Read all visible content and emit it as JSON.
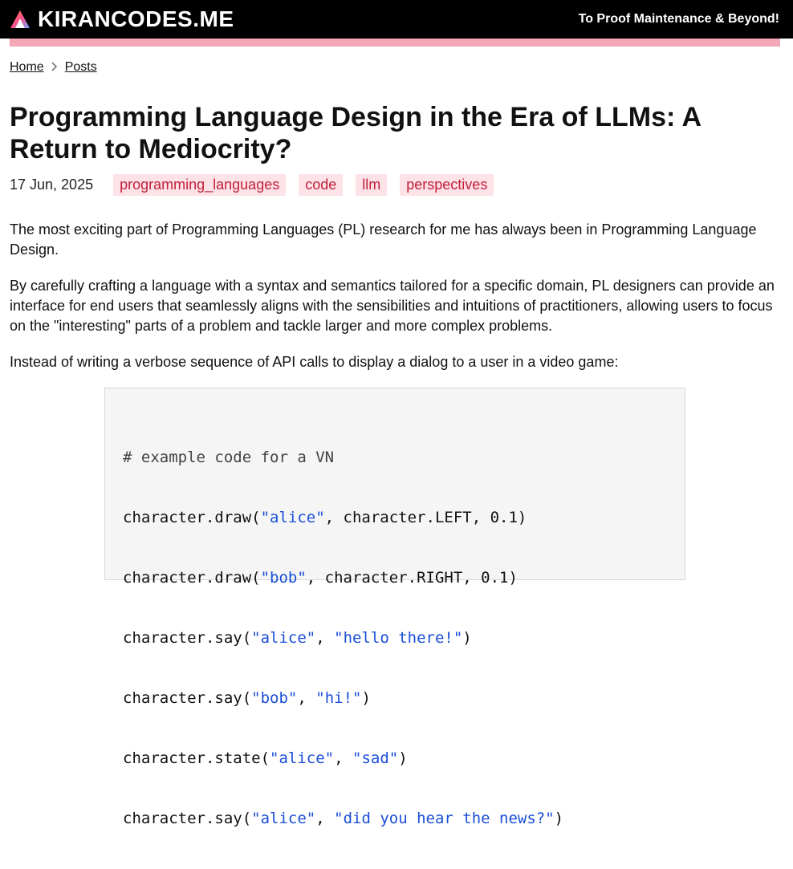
{
  "header": {
    "site_name": "KIRANCODES.ME",
    "tagline": "To Proof Maintenance & Beyond!",
    "logo_icon": "triangle-logo-icon"
  },
  "breadcrumb": {
    "home": "Home",
    "posts": "Posts",
    "separator_icon": "chevron-right-icon"
  },
  "post": {
    "title": "Programming Language Design in the Era of LLMs: A Return to Mediocrity?",
    "date": "17 Jun, 2025",
    "tags": [
      "programming_languages",
      "code",
      "llm",
      "perspectives"
    ],
    "paragraphs": [
      "The most exciting part of Programming Languages (PL) research for me has always been in Programming Language Design.",
      "By carefully crafting a language with a syntax and semantics tailored for a specific domain, PL designers can provide an interface for end users that seamlessly aligns with the sensibilities and intuitions of practitioners, allowing users to focus on the \"interesting\" parts of a problem and tackle larger and more complex problems.",
      "Instead of writing a verbose sequence of API calls to display a dialog to a user in a video game:"
    ],
    "code": {
      "comment": "# example code for a VN",
      "lines": [
        {
          "pre": "character.draw(",
          "s1": "\"alice\"",
          "mid": ", character.LEFT, 0.1)",
          "s2": "",
          "post": ""
        },
        {
          "pre": "character.draw(",
          "s1": "\"bob\"",
          "mid": ", character.RIGHT, 0.1)",
          "s2": "",
          "post": ""
        },
        {
          "pre": "character.say(",
          "s1": "\"alice\"",
          "mid": ", ",
          "s2": "\"hello there!\"",
          "post": ")"
        },
        {
          "pre": "character.say(",
          "s1": "\"bob\"",
          "mid": ", ",
          "s2": "\"hi!\"",
          "post": ")"
        },
        {
          "pre": "character.state(",
          "s1": "\"alice\"",
          "mid": ", ",
          "s2": "\"sad\"",
          "post": ")"
        },
        {
          "pre": "character.say(",
          "s1": "\"alice\"",
          "mid": ", ",
          "s2": "\"did you hear the news?\"",
          "post": ")"
        }
      ]
    }
  },
  "colors": {
    "header_bg": "#000000",
    "accent_pink": "#f4a7b6",
    "tag_bg": "#fde2e7",
    "tag_text": "#c21f3a",
    "code_string": "#1a4ed8"
  }
}
